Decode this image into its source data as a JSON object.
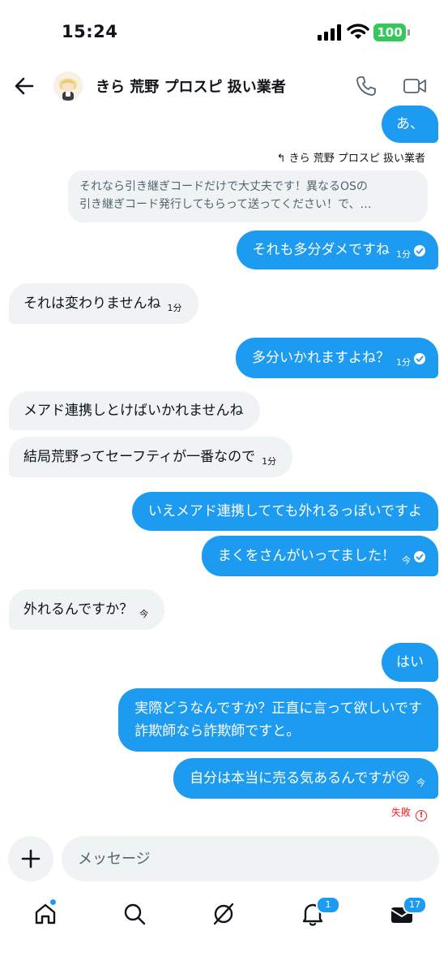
{
  "status_bar": {
    "time": "15:24",
    "battery": "100"
  },
  "header": {
    "contact_name": "きら 荒野 プロスピ 扱い業者"
  },
  "reply": {
    "label": "きら 荒野 プロスピ 扱い業者",
    "quote_line1": "それなら引き継ぎコードだけで大丈夫です！異なるOSの",
    "quote_line2": "引き継ぎコード発行してもらって送ってください！で、…"
  },
  "messages": [
    {
      "side": "out",
      "text": "あ、"
    },
    {
      "side": "out",
      "text": "それも多分ダメですね",
      "time": "1分"
    },
    {
      "side": "in",
      "text": "それは変わりませんね",
      "time": "1分"
    },
    {
      "side": "out",
      "text": "多分いかれますよね？",
      "time": "1分"
    },
    {
      "side": "in",
      "text": "メアド連携しとけばいかれませんね"
    },
    {
      "side": "in",
      "text": "結局荒野ってセーフティが一番なので",
      "time": "1分"
    },
    {
      "side": "out",
      "text": "いえメアド連携してても外れるっぽいですよ"
    },
    {
      "side": "out",
      "text": "まくをさんがいってました！",
      "time": "今"
    },
    {
      "side": "in",
      "text": "外れるんですか？",
      "time": "今"
    },
    {
      "side": "out",
      "text": "はい"
    },
    {
      "side": "out",
      "line1": "実際どうなんですか？正直に言って欲しいです",
      "line2": "詐欺師なら詐欺師ですと。"
    },
    {
      "side": "out",
      "text": "自分は本当に売る気あるんですが",
      "emoji": "😢",
      "time": "今"
    }
  ],
  "failed_label": "失敗",
  "composer": {
    "placeholder": "メッセージ"
  },
  "nav": {
    "notifications_badge": "1",
    "messages_badge": "17"
  },
  "colors": {
    "accent": "#1d9bf0",
    "incoming_bubble": "#eff3f4",
    "error": "#f4212e",
    "battery": "#34c759"
  }
}
